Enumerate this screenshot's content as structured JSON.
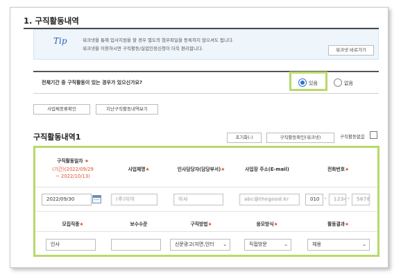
{
  "section": {
    "title": "1. 구직활동내역"
  },
  "tip": {
    "label": "Tip",
    "line1": "워크넷을 통해 입사지원을 할 경우 별도의 첨부파일을 등록하지 않으셔도 됩니다.",
    "line2": "워크넷을 이용하시면 구직활동/실업인정신청이 더욱 편리합니다.",
    "button": "워크넷 바로가기"
  },
  "question": {
    "text": "전체기간 중 구직활동이 있는 경우가 있으신가요?",
    "options": [
      {
        "label": "있음",
        "selected": true
      },
      {
        "label": "없음",
        "selected": false
      }
    ]
  },
  "action_buttons": [
    "사업체종류확인",
    "지난구직활동내역보기"
  ],
  "activity": {
    "title": "구직활동내역1",
    "reset_button": "초기화(-)",
    "worknet_button": "구직활동확인(워크넷)",
    "no_activity_label": "구직활동없음",
    "required_mark": "★",
    "header1": {
      "date": "구직활동일자",
      "period_line1": "(기간)(2022/09/29",
      "period_line2": "~ 2022/10/13)",
      "company": "사업체명",
      "manager": "인사담당자(담당부서)",
      "email": "사업장 주소(E-mail)",
      "phone": "전화번호"
    },
    "row1": {
      "date": "2022/09/30",
      "company": "(주)이이",
      "manager": "이사",
      "email": "abc@thegood.kr",
      "phone1": "010",
      "phone2": "1234",
      "phone3": "5678",
      "phone_sep": "-"
    },
    "header2": {
      "job": "모집직종",
      "salary": "보수수준",
      "method": "구직방법",
      "apply": "응모방식",
      "result": "활동결과"
    },
    "row2": {
      "job": "인사",
      "salary": "",
      "method": "신문광고(지면,인터",
      "apply": "직접방문",
      "result": "채용",
      "caret": "⌄"
    }
  },
  "colors": {
    "accent": "#b8d96a",
    "radio": "#2a6fd6",
    "required": "#e0502a"
  }
}
